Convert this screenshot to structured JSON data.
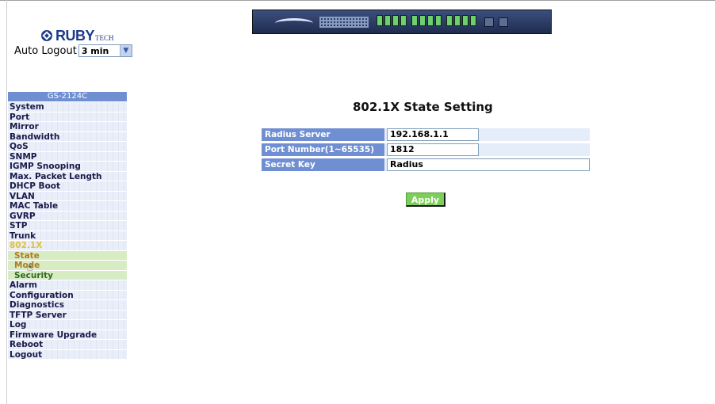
{
  "brand": {
    "logo_main": "RUBY",
    "logo_sub": "TECH"
  },
  "auto_logout": {
    "label": "Auto Logout",
    "value": "3 min"
  },
  "menu": {
    "header": "GS-2124C",
    "items": [
      {
        "label": "System",
        "active": false
      },
      {
        "label": "Port",
        "active": false
      },
      {
        "label": "Mirror",
        "active": false
      },
      {
        "label": "Bandwidth",
        "active": false
      },
      {
        "label": "QoS",
        "active": false
      },
      {
        "label": "SNMP",
        "active": false
      },
      {
        "label": "IGMP Snooping",
        "active": false
      },
      {
        "label": "Max. Packet Length",
        "active": false
      },
      {
        "label": "DHCP Boot",
        "active": false
      },
      {
        "label": "VLAN",
        "active": false
      },
      {
        "label": "MAC Table",
        "active": false
      },
      {
        "label": "GVRP",
        "active": false
      },
      {
        "label": "STP",
        "active": false
      },
      {
        "label": "Trunk",
        "active": false
      },
      {
        "label": "802.1X",
        "active": true
      }
    ],
    "sub_items": [
      {
        "label": "State",
        "style": "orange"
      },
      {
        "label": "Mode",
        "style": "orange"
      },
      {
        "label": "Security",
        "style": "green"
      }
    ],
    "items_after": [
      {
        "label": "Alarm"
      },
      {
        "label": "Configuration"
      },
      {
        "label": "Diagnostics"
      },
      {
        "label": "TFTP Server"
      },
      {
        "label": "Log"
      },
      {
        "label": "Firmware Upgrade"
      },
      {
        "label": "Reboot"
      },
      {
        "label": "Logout"
      }
    ]
  },
  "main": {
    "title": "802.1X State Setting",
    "fields": [
      {
        "label": "Radius Server",
        "value": "192.168.1.1"
      },
      {
        "label": "Port Number(1~65535)",
        "value": "1812"
      },
      {
        "label": "Secret Key",
        "value": "Radius"
      }
    ],
    "apply_label": "Apply"
  },
  "colors": {
    "menu_bg": "#e9eef8",
    "header_blue": "#6f8fd2",
    "active_text": "#e0c040",
    "apply_green": "#7ecf5a"
  }
}
